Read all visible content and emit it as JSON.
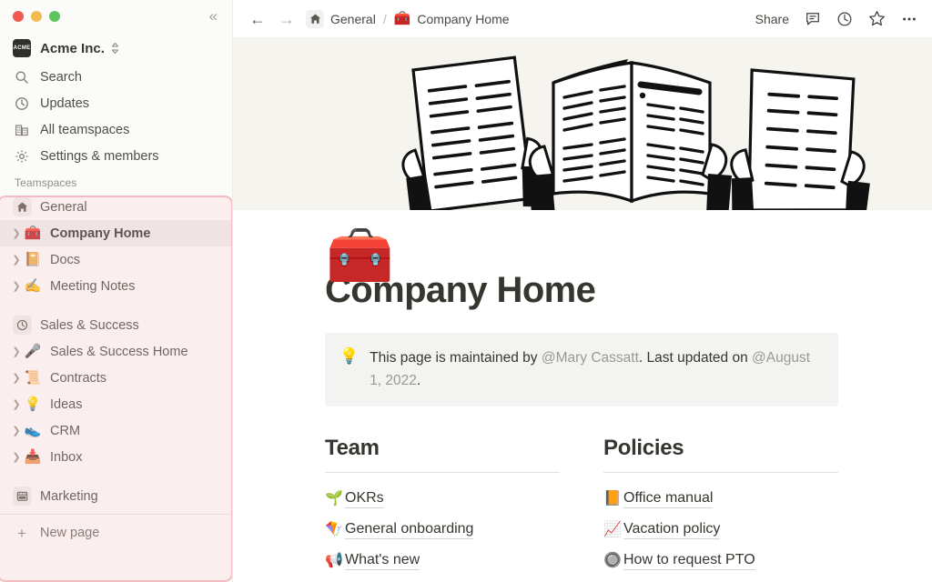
{
  "window": {
    "traffic_lights": [
      {
        "name": "close",
        "color": "#f05a50"
      },
      {
        "name": "minimize",
        "color": "#f0bb50"
      },
      {
        "name": "maximize",
        "color": "#5ec45e"
      }
    ],
    "collapse_label": "«"
  },
  "sidebar": {
    "workspace": {
      "logo_text": "ACME",
      "name": "Acme Inc.",
      "switch_icon": "chevron-updown-icon"
    },
    "nav": [
      {
        "label": "Search",
        "icon": "search-icon"
      },
      {
        "label": "Updates",
        "icon": "clock-icon"
      },
      {
        "label": "All teamspaces",
        "icon": "buildings-icon"
      },
      {
        "label": "Settings & members",
        "icon": "gear-icon"
      }
    ],
    "teamspaces_header": "Teamspaces",
    "teamspaces": [
      {
        "label": "General",
        "icon_type": "badge",
        "icon": "home-icon",
        "caret": false,
        "selected": false,
        "bold": false,
        "sub": false
      },
      {
        "label": "Company Home",
        "icon_type": "emoji",
        "emoji": "🧰",
        "icon": "toolbox-emoji",
        "caret": true,
        "selected": true,
        "bold": true,
        "sub": true
      },
      {
        "label": "Docs",
        "icon_type": "emoji",
        "emoji": "📔",
        "icon": "notebook-emoji",
        "caret": true,
        "selected": false,
        "bold": false,
        "sub": true
      },
      {
        "label": "Meeting Notes",
        "icon_type": "emoji",
        "emoji": "✍️",
        "icon": "writing-hand-emoji",
        "caret": true,
        "selected": false,
        "bold": false,
        "sub": true
      },
      {
        "label": "Sales & Success",
        "icon_type": "badge",
        "icon": "clock-icon",
        "caret": false,
        "selected": false,
        "bold": false,
        "sub": false,
        "spaced": true
      },
      {
        "label": "Sales & Success Home",
        "icon_type": "emoji",
        "emoji": "🎤",
        "icon": "microphone-emoji",
        "caret": true,
        "selected": false,
        "bold": false,
        "sub": true
      },
      {
        "label": "Contracts",
        "icon_type": "emoji",
        "emoji": "📜",
        "icon": "scroll-emoji",
        "caret": true,
        "selected": false,
        "bold": false,
        "sub": true
      },
      {
        "label": "Ideas",
        "icon_type": "emoji",
        "emoji": "💡",
        "icon": "lightbulb-emoji",
        "caret": true,
        "selected": false,
        "bold": false,
        "sub": true
      },
      {
        "label": "CRM",
        "icon_type": "emoji",
        "emoji": "👟",
        "icon": "shoe-emoji",
        "caret": true,
        "selected": false,
        "bold": false,
        "sub": true
      },
      {
        "label": "Inbox",
        "icon_type": "emoji",
        "emoji": "📥",
        "icon": "inbox-tray-emoji",
        "caret": true,
        "selected": false,
        "bold": false,
        "sub": true
      },
      {
        "label": "Marketing",
        "icon_type": "badge",
        "icon": "calendar-icon",
        "caret": false,
        "selected": false,
        "bold": false,
        "sub": false,
        "spaced": true
      }
    ],
    "new_page": {
      "label": "New page",
      "icon": "plus-icon"
    },
    "highlight_color": "#f3bcc2"
  },
  "topbar": {
    "back_icon": "arrow-left-icon",
    "forward_icon": "arrow-right-icon",
    "breadcrumb": {
      "home_icon": "home-icon",
      "parent": "General",
      "separator": "/",
      "current_emoji": "🧰",
      "current": "Company Home"
    },
    "share_label": "Share",
    "actions": [
      {
        "name": "comment-icon"
      },
      {
        "name": "history-clock-icon"
      },
      {
        "name": "star-icon"
      },
      {
        "name": "more-options-icon"
      }
    ]
  },
  "page": {
    "cover_bg": "#f5f4ef",
    "cover_alt": "three hands holding documents illustration",
    "icon_emoji": "🧰",
    "title": "Company Home",
    "callout": {
      "emoji": "💡",
      "text_before": "This page is maintained by ",
      "mention_person": "@Mary Cassatt",
      "text_middle": ". Last updated on ",
      "mention_date": "@August 1, 2022",
      "text_after": "."
    },
    "columns": [
      {
        "heading": "Team",
        "links": [
          {
            "emoji": "🌱",
            "icon": "seedling-emoji",
            "label": "OKRs"
          },
          {
            "emoji": "🪁",
            "icon": "kite-emoji",
            "label": "General onboarding"
          },
          {
            "emoji": "📢",
            "icon": "loudspeaker-emoji",
            "label": "What's new"
          }
        ]
      },
      {
        "heading": "Policies",
        "links": [
          {
            "emoji": "📙",
            "icon": "orange-book-emoji",
            "label": "Office manual"
          },
          {
            "emoji": "📈",
            "icon": "chart-increasing-emoji",
            "label": "Vacation policy"
          },
          {
            "emoji": "🔘",
            "icon": "radio-button-emoji",
            "label": "How to request PTO"
          }
        ]
      }
    ]
  }
}
